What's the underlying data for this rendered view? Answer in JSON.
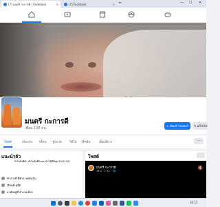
{
  "browser": {
    "tabs": [
      {
        "label": "(7) มนตรี กะการดี | Facebook",
        "active": true
      },
      {
        "label": "(7) Facebook",
        "active": false
      }
    ],
    "new_tab_label": "+",
    "window_controls": [
      "—",
      "☐",
      "✕"
    ]
  },
  "fb_nav": {
    "icons": [
      "home-icon",
      "video-icon",
      "marketplace-icon",
      "groups-icon",
      "gaming-icon"
    ],
    "active": "home-icon"
  },
  "profile": {
    "name": "มนตรี กะการดี",
    "friends": "เพื่อน 108 คน",
    "add_story_label": "+ เพิ่มเข้าในสตอรี่",
    "edit_label": "✎ แก้ไขโปร"
  },
  "profile_tabs": [
    "โพสต์",
    "เกี่ยวกับ",
    "เพื่อน",
    "รูปภาพ",
    "วิดีโอ",
    "เช็คอิน",
    "เพิ่มเติม ▾"
  ],
  "more_label": "···",
  "intro": {
    "title": "แนะนำตัว",
    "bio": "รักในสิ่งที่ทำ ทำในสิ่งที่รักและทำให้ดีที่สุด 20/11/20",
    "rows": [
      "ทำงานที่ ที่ทำงานปัจจุบัน",
      "เรียนที่ ดุสิต",
      "อาศัยอยู่ที่ อำเภอเมือง"
    ]
  },
  "posts": {
    "title": "โพสต์",
    "video_author": "มนตรี กะการดี",
    "video_time": "วิดีโอ · 2 ชม. · 🌐",
    "sound_icon": "🔇"
  },
  "taskbar": {
    "icons": [
      "start-icon",
      "search-icon",
      "explorer-icon",
      "edge-icon",
      "chrome-icon",
      "store-icon",
      "mail-icon",
      "photos-icon",
      "settings-icon",
      "word-icon",
      "line-icon",
      "zoom-icon"
    ],
    "time": "10:15"
  },
  "colors": {
    "accent": "#1877f2",
    "page_bg": "#f0f2f5"
  }
}
